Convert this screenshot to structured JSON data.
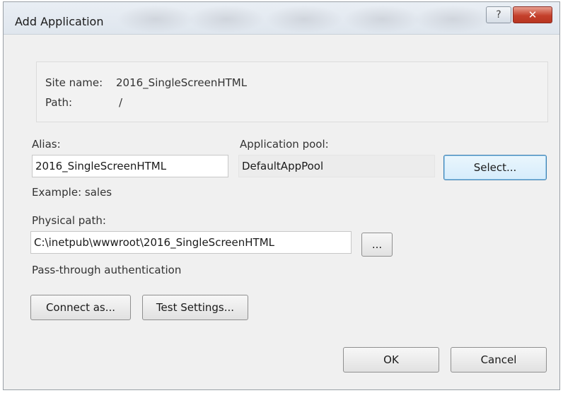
{
  "window": {
    "title": "Add Application",
    "help_label": "?",
    "close_label": "✕"
  },
  "site_info": {
    "site_name_label": "Site name:",
    "site_name_value": "2016_SingleScreenHTML",
    "path_label": "Path:",
    "path_value": "/"
  },
  "alias": {
    "label": "Alias:",
    "value": "2016_SingleScreenHTML",
    "example": "Example: sales"
  },
  "app_pool": {
    "label": "Application pool:",
    "value": "DefaultAppPool",
    "select_label": "Select..."
  },
  "physical_path": {
    "label": "Physical path:",
    "value": "C:\\inetpub\\wwwroot\\2016_SingleScreenHTML",
    "browse_label": "..."
  },
  "auth": {
    "label": "Pass-through authentication",
    "connect_label": "Connect as...",
    "test_label": "Test Settings..."
  },
  "footer": {
    "ok_label": "OK",
    "cancel_label": "Cancel"
  }
}
